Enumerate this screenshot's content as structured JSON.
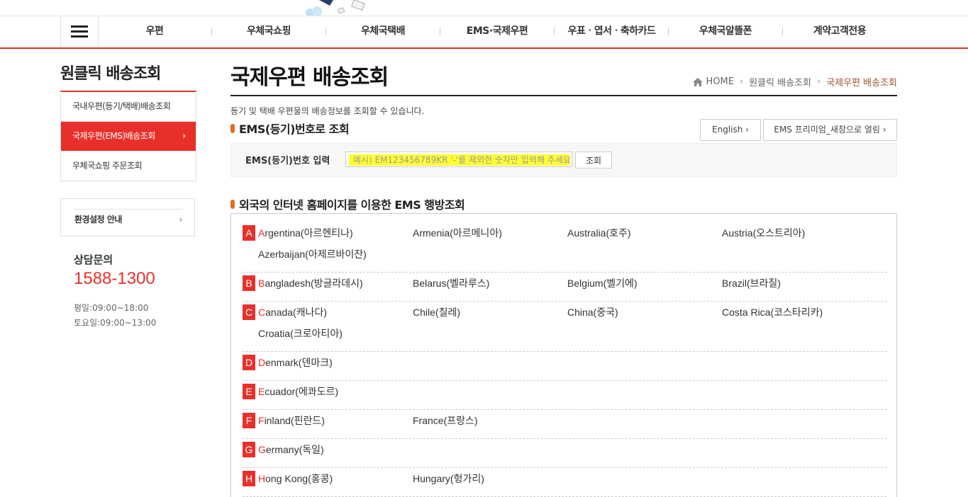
{
  "nav": {
    "items": [
      "우편",
      "우체국쇼핑",
      "우체국택배",
      "EMS·국제우편",
      "우표ㆍ엽서ㆍ축하카드",
      "우체국알뜰폰",
      "계약고객전용"
    ]
  },
  "sidebar": {
    "title": "원클릭 배송조회",
    "items": [
      {
        "label": "국내우편(등기/택배)배송조회"
      },
      {
        "label": "국제우편(EMS)배송조회"
      },
      {
        "label": "우체국쇼핑 주문조회"
      }
    ],
    "settings_label": "환경설정 안내",
    "contact": {
      "title": "상담문의",
      "phone": "1588-1300",
      "weekday": "평일:09:00~18:00",
      "saturday": "토요일:09:00~13:00"
    }
  },
  "main": {
    "title": "국제우편 배송조회",
    "breadcrumb": [
      "HOME",
      "원클릭 배송조회",
      "국제우편 배송조회"
    ],
    "description": "등기 및 택배 우편물의 배송정보를 조회할 수 있습니다.",
    "section1_title": "EMS(등기)번호로 조회",
    "english_button": "English",
    "premium_button": "EMS 프리미엄_새창으로 열림",
    "search_label": "EMS(등기)번호 입력",
    "search_placeholder": "예시) EM123456789KR '-'를 제외한 숫자만 입력해 주세요",
    "search_button": "조회",
    "section2_title": "외국의 인터넷 홈페이지를 이용한 EMS 행방조회"
  },
  "countries": [
    {
      "letter": "A",
      "names": [
        "Argentina(아르헨티나)",
        "Armenia(아르메니아)",
        "Australia(호주)",
        "Austria(오스트리아)",
        "Azerbaijan(아제르바이잔)"
      ]
    },
    {
      "letter": "B",
      "names": [
        "Bangladesh(방글라데시)",
        "Belarus(벨라루스)",
        "Belgium(벨기에)",
        "Brazil(브라질)"
      ]
    },
    {
      "letter": "C",
      "names": [
        "Canada(캐나다)",
        "Chile(칠레)",
        "China(중국)",
        "Costa Rica(코스타리카)",
        "Croatia(크로아티아)"
      ]
    },
    {
      "letter": "D",
      "names": [
        "Denmark(덴마크)"
      ]
    },
    {
      "letter": "E",
      "names": [
        "Ecuador(에콰도르)"
      ]
    },
    {
      "letter": "F",
      "names": [
        "Finland(핀란드)",
        "France(프랑스)"
      ]
    },
    {
      "letter": "G",
      "names": [
        "Germany(독일)"
      ]
    },
    {
      "letter": "H",
      "names": [
        "Hong Kong(홍콩)",
        "Hungary(헝가리)"
      ]
    }
  ],
  "colors": {
    "accent": "#e8302b",
    "bullet": "#e86a1c",
    "highlight": "#ffff33"
  }
}
